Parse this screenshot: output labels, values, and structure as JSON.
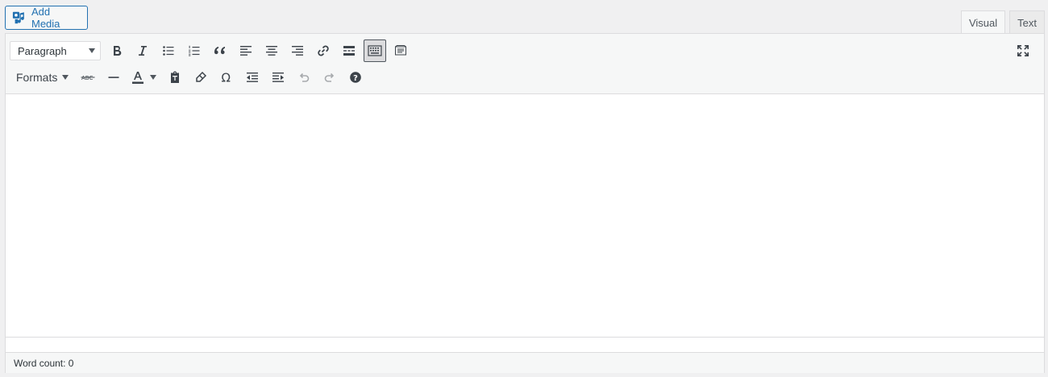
{
  "add_media": {
    "label": "Add Media",
    "icon": "media-icon"
  },
  "tabs": [
    {
      "label": "Visual",
      "active": true
    },
    {
      "label": "Text",
      "active": false
    }
  ],
  "toolbar": {
    "block_format": {
      "selected": "Paragraph"
    },
    "row1_buttons": [
      "bold-icon",
      "italic-icon",
      "bullet-list-icon",
      "numbered-list-icon",
      "blockquote-icon",
      "align-left-icon",
      "align-center-icon",
      "align-right-icon",
      "link-icon",
      "read-more-icon",
      "toolbar-toggle-icon",
      "distraction-free-icon"
    ],
    "formats_label": "Formats",
    "row2_buttons": [
      "strikethrough-icon",
      "horizontal-line-icon",
      "text-color-icon",
      "paste-as-text-icon",
      "clear-formatting-icon",
      "special-character-icon",
      "outdent-icon",
      "indent-icon",
      "undo-icon",
      "redo-icon",
      "help-icon"
    ],
    "fullscreen_icon": "fullscreen-icon"
  },
  "status": {
    "word_count": "Word count: 0"
  },
  "colors": {
    "accent": "#2271b1",
    "toolbar_bg": "#f6f7f7",
    "page_bg": "#f0f0f1"
  }
}
